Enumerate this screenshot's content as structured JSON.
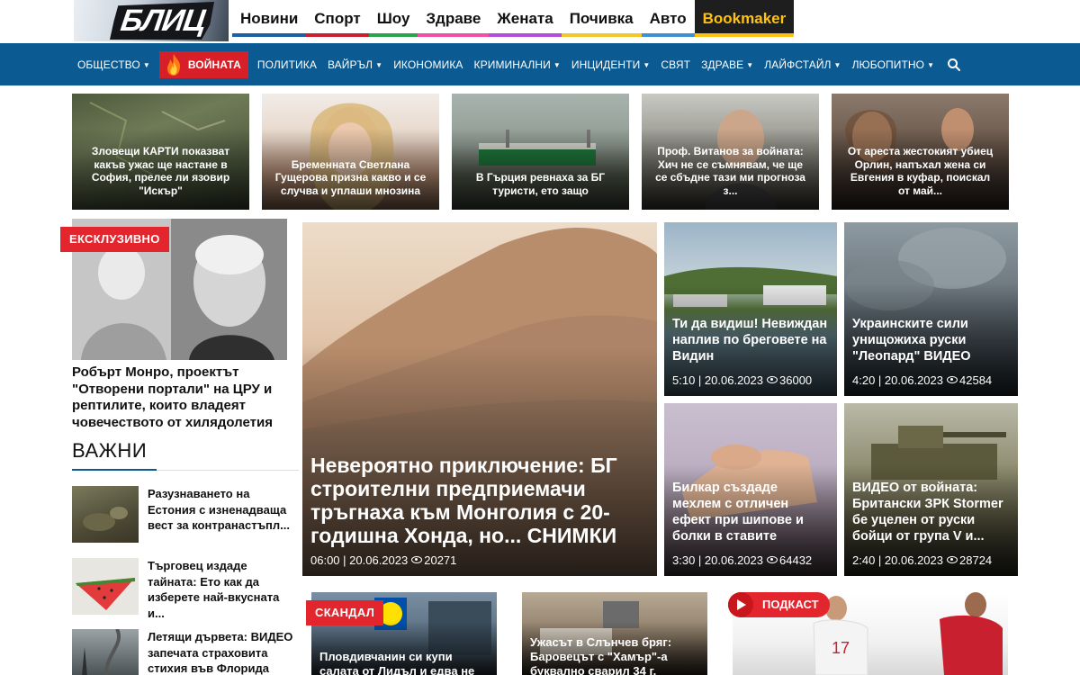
{
  "logo": {
    "text": "БЛИЦ"
  },
  "top_nav": [
    {
      "label": "Новини",
      "color": "#1d5fa6"
    },
    {
      "label": "Спорт",
      "color": "#c8202f"
    },
    {
      "label": "Шоу",
      "color": "#2aa34a"
    },
    {
      "label": "Здраве",
      "color": "#ef4fa6"
    },
    {
      "label": "Жената",
      "color": "#b04fd9"
    },
    {
      "label": "Почивка",
      "color": "#f1c82a"
    },
    {
      "label": "Авто",
      "color": "#3d8fd6"
    },
    {
      "label": "Bookmaker",
      "color": "#ffc20e"
    }
  ],
  "blue_nav": [
    {
      "label": "Общество",
      "dropdown": true
    },
    {
      "label": "Войната",
      "dropdown": false,
      "highlight": true
    },
    {
      "label": "Политика",
      "dropdown": false
    },
    {
      "label": "Вайръл",
      "dropdown": true
    },
    {
      "label": "Икономика",
      "dropdown": false
    },
    {
      "label": "Криминални",
      "dropdown": true
    },
    {
      "label": "Инциденти",
      "dropdown": true
    },
    {
      "label": "Свят",
      "dropdown": false
    },
    {
      "label": "Здраве",
      "dropdown": true
    },
    {
      "label": "Лайфстайл",
      "dropdown": true
    },
    {
      "label": "Любопитно",
      "dropdown": true
    }
  ],
  "top_cards": [
    {
      "title": "Зловещи КАРТИ показват какъв ужас ще настане в София, прелее ли язовир \"Искър\""
    },
    {
      "title": "Бременната Светлана Гущерова призна какво и се случва и уплаши мнозина"
    },
    {
      "title": "В Гърция ревнаха за БГ туристи, ето защо"
    },
    {
      "title": "Проф. Витанов за войната: Хич не се съмнявам, че ще се сбъдне тази ми прогноза з..."
    },
    {
      "title": "От ареста жестокият убиец Орлин, напъхал жена си Евгения в куфар, поискал от май..."
    }
  ],
  "exclusive": {
    "badge": "ЕКСКЛУЗИВНО",
    "title": "Робърт Монро, проектът \"Отворени портали\" на ЦРУ и рептилите, които владеят човечеството от хилядолетия"
  },
  "main_story": {
    "title": "Невероятно приключение: БГ строителни предприемачи тръгнаха към Монголия с 20-годишна Хонда, но... СНИМКИ",
    "time": "06:00",
    "date": "20.06.2023",
    "views": "20271"
  },
  "grid": [
    {
      "title": "Ти да видиш! Невиждан наплив по бреговете на Видин",
      "time": "5:10",
      "date": "20.06.2023",
      "views": "36000"
    },
    {
      "title": "Украинските сили унищожиха руски \"Леопард\" ВИДЕО",
      "time": "4:20",
      "date": "20.06.2023",
      "views": "42584"
    },
    {
      "title": "Билкар създаде мехлем с отличен ефект при шипове и болки в ставите",
      "time": "3:30",
      "date": "20.06.2023",
      "views": "64432"
    },
    {
      "title": "ВИДЕО от войната: Британски ЗРК Stormer бе уцелен от руски бойци от група V и...",
      "time": "2:40",
      "date": "20.06.2023",
      "views": "28724"
    }
  ],
  "important": {
    "heading": "ВАЖНИ",
    "items": [
      {
        "title": "Разузнаването на Естония с изненадваща вест за контранастъпл..."
      },
      {
        "title": "Търговец издаде тайната: Ето как да изберете най-вкусната и..."
      },
      {
        "title": "Летящи дървета: ВИДЕО запечата страховита стихия във Флорида"
      }
    ]
  },
  "bottom_cards": [
    {
      "badge": "СКАНДАЛ",
      "title": "Пловдивчанин си купи салата от Лидъл и едва не"
    },
    {
      "title": "Ужасът в Слънчев бряг: Баровецът с \"Хамър\"-а буквално сварил 34 г."
    },
    {
      "badge": "ПОДКАСТ"
    }
  ]
}
